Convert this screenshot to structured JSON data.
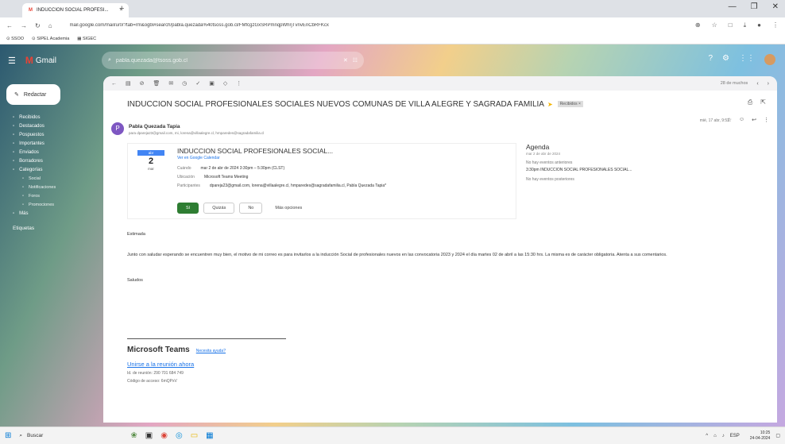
{
  "browser": {
    "tab_title": "INDUCCION SOCIAL PROFESI...",
    "tab_close": "×",
    "new_tab": "+",
    "url": "mail.google.com/mail/u/0/?tab=rm&ogbl#search/pabla.quezada%40tsoss.gob.cl/FMfcgzGxSRPmnqpWhrjTvnvEnCbRFKcx",
    "bookmarks": [
      "SSOO",
      "SIPEL Academia",
      "SIGEC"
    ],
    "window_controls": [
      "—",
      "❐",
      "✕"
    ]
  },
  "gmail": {
    "logo": "Gmail",
    "search_value": "pabla.quezada@tsoss.gob.cl",
    "compose": "Redactar",
    "nav": [
      {
        "label": "Recibidos",
        "indent": false
      },
      {
        "label": "Destacados",
        "indent": false
      },
      {
        "label": "Pospuestos",
        "indent": false
      },
      {
        "label": "Importantes",
        "indent": false
      },
      {
        "label": "Enviados",
        "indent": false
      },
      {
        "label": "Borradores",
        "indent": false
      },
      {
        "label": "Categorías",
        "indent": false
      },
      {
        "label": "Social",
        "indent": true
      },
      {
        "label": "Notificaciones",
        "indent": true
      },
      {
        "label": "Foros",
        "indent": true
      },
      {
        "label": "Promociones",
        "indent": true
      },
      {
        "label": "Más",
        "indent": false
      }
    ],
    "labels_heading": "Etiquetas",
    "pagination": "28 de muchos"
  },
  "email": {
    "subject": "INDUCCION SOCIAL PROFESIONALES SOCIALES NUEVOS COMUNAS DE VILLA ALEGRE Y SAGRADA FAMILIA",
    "label_badge": "Recibidos ×",
    "sender_initial": "P",
    "sender_name": "Pabla Quezada Tapia",
    "sender_to": "para dpareja23@gmail.com, mi, lorena@villaalegre.cl, hmparedes@sagradafamilia.cl",
    "date": "mié, 17 abr, 9:52",
    "invite": {
      "month": "abr",
      "day": "2",
      "dow": "mar",
      "title": "INDUCCION SOCIAL PROFESIONALES SOCIAL...",
      "view_link": "Ver en Google Calendar",
      "when_label": "Cuándo",
      "when_value": "mar 2 de abr de 2024 3:30pm – 5:30pm (CLST)",
      "where_label": "Ubicación",
      "where_value": "Microsoft Teams Meeting",
      "guests_label": "Participantes",
      "guests_value": "dpareja23@gmail.com, lorena@villaalegre.cl, hmparedes@sagradafamilia.cl, Pabla Quezada Tapia*",
      "rsvp_yes": "Sí",
      "rsvp_maybe": "Quizás",
      "rsvp_no": "No",
      "rsvp_more": "Más opciones"
    },
    "agenda": {
      "title": "Agenda",
      "date": "mar 2 de abr de 2024",
      "no_earlier": "No hay eventos anteriores",
      "event": "3:30pm  INDUCCION SOCIAL PROFESIONALES SOCIAL...",
      "no_later": "No hay eventos posteriores"
    },
    "greeting": "Estimada",
    "body": "Junto con saludar esperando se encuentren muy bien, el motivo de mi correo es para invitarlos a la inducción Social de profesionales nuevos en las convocatoria 2023 y 2024 el día martes 02 de abril a las 15:30 hrs. La misma es de carácter obligatoria. Atenta a sus comentarios.",
    "signoff": "Saludos",
    "teams": {
      "title": "Microsoft Teams",
      "help": "Necesita ayuda?",
      "join": "Unirse a la reunión ahora",
      "meeting_id": "Id. de reunión: 290 701 684 749",
      "passcode": "Código de acceso: 6mQPxV"
    }
  },
  "taskbar": {
    "search": "Buscar",
    "lang": "ESP",
    "time": "10:25",
    "date": "24-04-2024"
  },
  "colors": {
    "accent": "#1a73e8",
    "yes_button": "#2e7d32",
    "gmail_red": "#ea4335",
    "calendar_blue": "#4285f4"
  }
}
